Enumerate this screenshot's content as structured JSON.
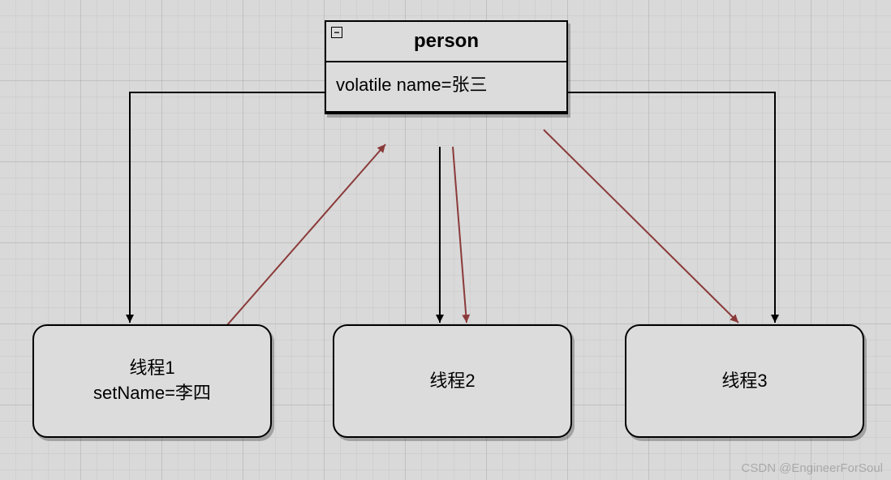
{
  "umlClass": {
    "title": "person",
    "attribute": "volatile name=张三",
    "collapseGlyph": "−"
  },
  "threads": {
    "t1": {
      "label": "线程1",
      "detail": "setName=李四"
    },
    "t2": {
      "label": "线程2"
    },
    "t3": {
      "label": "线程3"
    }
  },
  "watermark": "CSDN @EngineerForSoul",
  "colors": {
    "arrowBlack": "#000000",
    "arrowRed": "#8b3a3a"
  }
}
